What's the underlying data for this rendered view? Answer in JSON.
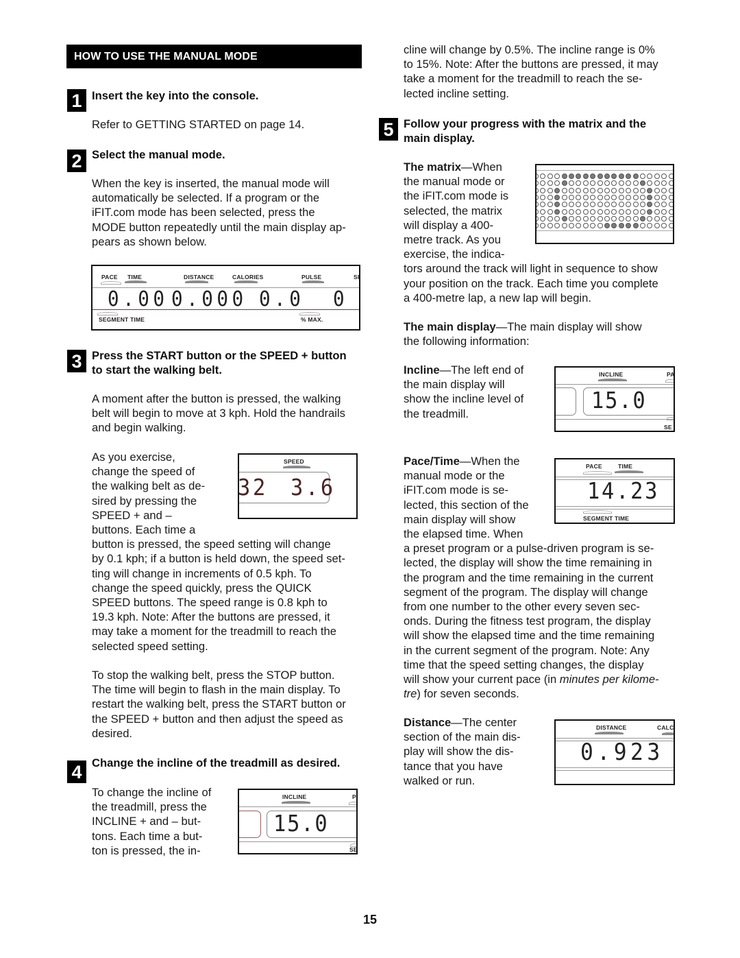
{
  "section_title": "HOW TO USE THE MANUAL MODE",
  "steps": [
    {
      "number": "1",
      "heading": "Insert the key into the console.",
      "body": [
        "Refer to GETTING STARTED on page 14."
      ]
    },
    {
      "number": "2",
      "heading": "Select the manual mode.",
      "body": [
        "When the key is inserted, the manual mode will",
        "automatically be selected. If a program or the",
        "iFIT.com mode has been selected, press the",
        "MODE button repeatedly until the main display ap-",
        "pears as shown below."
      ]
    },
    {
      "number": "3",
      "heading_lines": [
        "Press the START button or the SPEED + button",
        "to start the walking belt."
      ],
      "body": [
        "A moment after the button is pressed, the walking",
        "belt will begin to move at 3 kph. Hold the handrails",
        "and begin walking."
      ],
      "speed_text_wrapped": [
        "As you exercise,",
        "change the speed of",
        "the walking belt as de-",
        "sired by pressing the",
        "SPEED + and –",
        "buttons. Each time a"
      ],
      "speed_text_full": [
        "button is pressed, the speed setting will change",
        "by 0.1 kph; if a button is held down, the speed set-",
        "ting will change in increments of 0.5 kph. To",
        "change the speed quickly, press the QUICK",
        "SPEED buttons. The speed range is 0.8 kph to",
        "19.3 kph. Note: After the buttons are pressed, it",
        "may take a moment for the treadmill to reach the",
        "selected speed setting."
      ],
      "stop_text": [
        "To stop the walking belt, press the STOP button.",
        "The time will begin to flash in the main display. To",
        "restart the walking belt, press the START button or",
        "the SPEED + button and then adjust the speed as",
        "desired."
      ]
    },
    {
      "number": "4",
      "heading": "Change the incline of the treadmill as desired.",
      "body_wrapped": [
        "To change the incline of",
        "the treadmill, press the",
        "INCLINE + and – but-",
        "tons. Each time a but-",
        "ton is pressed, the in-"
      ],
      "body_continued": [
        "cline will change by 0.5%. The incline range is 0%",
        "to 15%. Note: After the buttons are pressed, it may",
        "take a moment for the treadmill to reach the se-",
        "lected incline setting."
      ]
    },
    {
      "number": "5",
      "heading_lines": [
        "Follow your progress with the matrix and the",
        "main display."
      ],
      "matrix": {
        "term": "The matrix",
        "text_wrapped": [
          "—When",
          "the manual mode or",
          "the iFIT.com mode is",
          "selected, the matrix",
          "will display a 400-",
          "metre track. As you",
          "exercise, the indica-"
        ],
        "text_full": [
          "tors around the track will light in sequence to show",
          "your position on the track. Each time you complete",
          "a 400-metre lap, a new lap will begin."
        ]
      },
      "main_display": {
        "term": "The main display",
        "text": [
          "—The main display will show",
          "the following information:"
        ]
      },
      "incline": {
        "term": "Incline",
        "text": [
          "—The left end of",
          "the main display will",
          "show the incline level of",
          "the treadmill."
        ]
      },
      "pace_time": {
        "term": "Pace/Time",
        "text_wrapped": [
          "—When the",
          "manual mode or the",
          "iFIT.com mode is se-",
          "lected, this section of the",
          "main display will show",
          "the elapsed time. When"
        ],
        "text_full_pre": [
          "a preset program or a pulse-driven program is se-",
          "lected, the display will show the time remaining in",
          "the program and the time remaining in the current",
          "segment of the program. The display will change",
          "from one number to the other every seven sec-",
          "onds. During the fitness test program, the display",
          "will show the elapsed time and the time remaining",
          "in the current segment of the program. Note: Any",
          "time that the speed setting changes, the display"
        ],
        "line_pace_a": "will show your current pace (in ",
        "line_pace_italic": "minutes per kilome-",
        "line_pace_b_italic": "tre",
        "line_pace_b": ") for seven seconds."
      },
      "distance": {
        "term": "Distance",
        "text": [
          "—The center",
          "section of the main dis-",
          "play will show the dis-",
          "tance that you have",
          "walked or run."
        ]
      }
    }
  ],
  "displays": {
    "full": {
      "labels": [
        "PACE",
        "TIME",
        "DISTANCE",
        "CALORIES",
        "PULSE",
        "SP"
      ],
      "readouts": [
        "0.00",
        "0.000",
        "0.0",
        "0"
      ],
      "bottom_labels": [
        "SEGMENT TIME",
        "% MAX."
      ]
    },
    "speed": {
      "label": "SPEED",
      "readout_left": "32",
      "readout": "3.6"
    },
    "incline": {
      "label": "INCLINE",
      "side_label_top": "P",
      "side_label_bottom": "SE",
      "readout": "15.0"
    },
    "incline_right": {
      "label": "INCLINE",
      "side_label_top": "PA",
      "side_label_bottom": "SE",
      "readout": "15.0"
    },
    "pace_time": {
      "labels": [
        "PACE",
        "TIME"
      ],
      "readout": "14.23",
      "bottom_label": "SEGMENT TIME"
    },
    "distance": {
      "label": "DISTANCE",
      "side_label": "CALC",
      "readout": "0.923"
    }
  },
  "matrix_pattern": [
    [
      3,
      4,
      5,
      6,
      7,
      8,
      9,
      10,
      11,
      12,
      13
    ],
    [
      3,
      14
    ],
    [
      2,
      15
    ],
    [
      2,
      15
    ],
    [
      2,
      15
    ],
    [
      2,
      15
    ],
    [
      3,
      14
    ],
    [
      9,
      10,
      11,
      12,
      13
    ]
  ],
  "page_number": "15"
}
